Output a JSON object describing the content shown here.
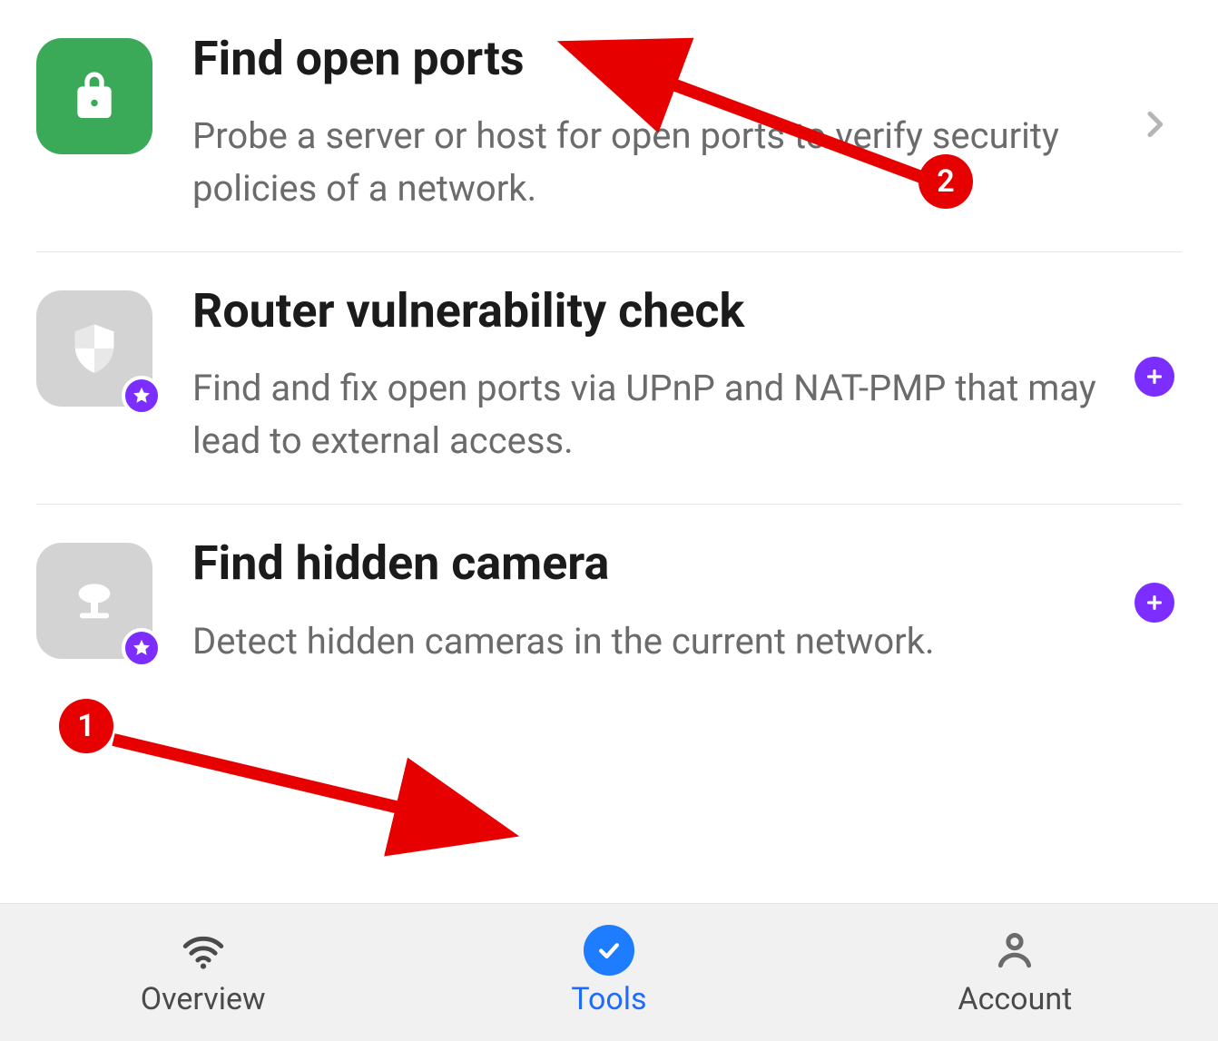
{
  "tools": [
    {
      "title": "Find open ports",
      "desc": "Probe a server or host for open ports to verify security policies of a network.",
      "icon": "lock-icon",
      "icon_bg": "green",
      "premium": false,
      "accessory": "chevron"
    },
    {
      "title": "Router vulnerability check",
      "desc": "Find and fix open ports via UPnP and NAT-PMP that may lead to external access.",
      "icon": "shield-icon",
      "icon_bg": "gray",
      "premium": true,
      "accessory": "plus"
    },
    {
      "title": "Find hidden camera",
      "desc": "Detect hidden cameras in the current network.",
      "icon": "camera-icon",
      "icon_bg": "gray",
      "premium": true,
      "accessory": "plus"
    }
  ],
  "nav": {
    "overview": "Overview",
    "tools": "Tools",
    "account": "Account",
    "active": "tools"
  },
  "annotations": {
    "badge1": "1",
    "badge2": "2"
  },
  "colors": {
    "accent_green": "#3aaa58",
    "accent_purple": "#7c2dff",
    "accent_blue": "#1e6bff",
    "annotation_red": "#e60000"
  }
}
